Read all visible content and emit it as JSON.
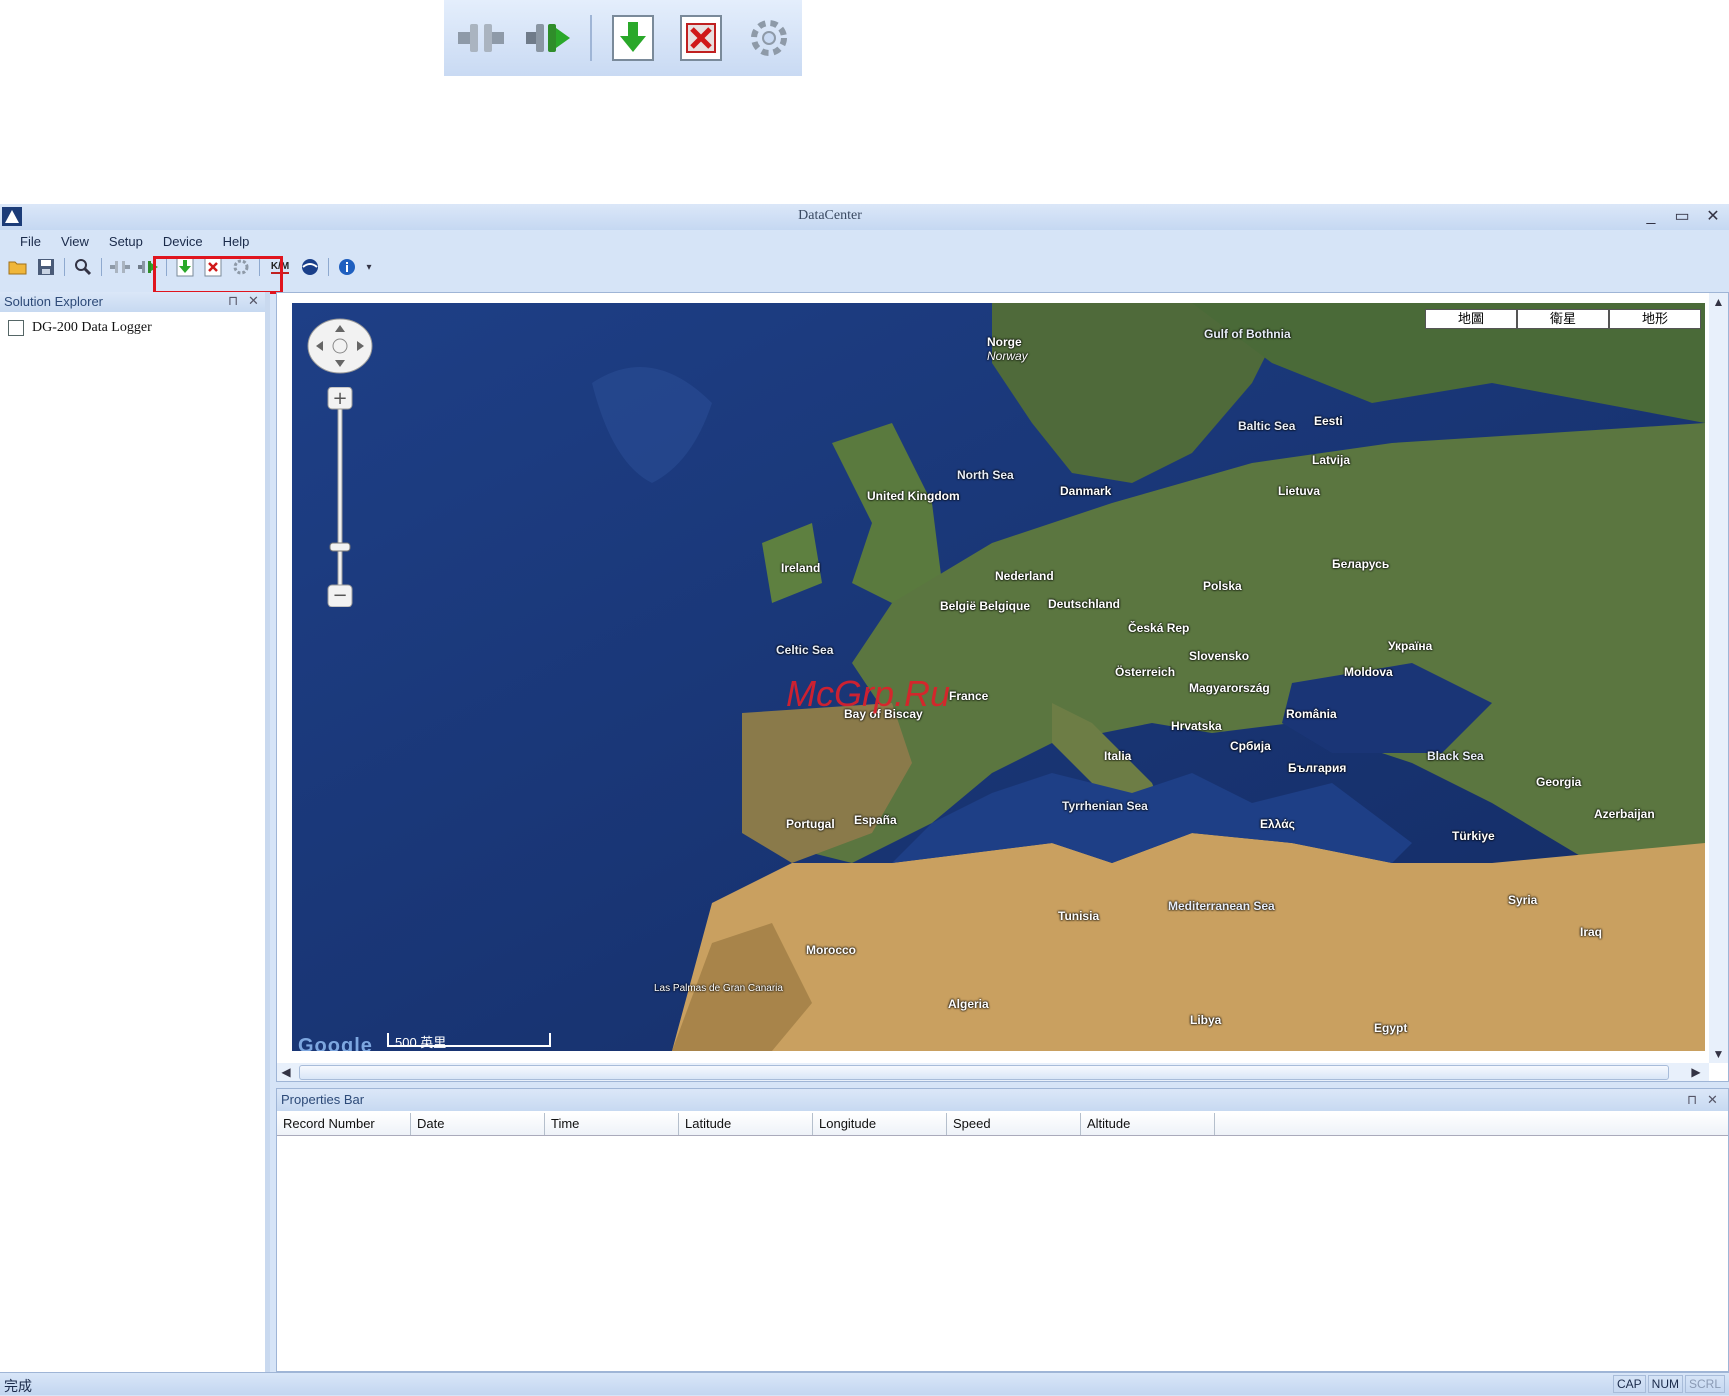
{
  "window": {
    "title": "DataCenter",
    "minimize_icon": "minimize-icon",
    "restore_icon": "restore-icon",
    "close_icon": "close-icon"
  },
  "menu": [
    "File",
    "View",
    "Setup",
    "Device",
    "Help"
  ],
  "toolbar": {
    "icons": [
      "open-folder-icon",
      "save-icon",
      "search-icon",
      "disconnect-icon",
      "connect-icon",
      "download-icon",
      "delete-icon",
      "settings-icon",
      "kml-export-icon",
      "google-earth-icon",
      "info-icon"
    ],
    "km_label": "K/M"
  },
  "solution_explorer": {
    "title": "Solution Explorer",
    "items": [
      {
        "label": "DG-200 Data Logger",
        "checked": false
      }
    ]
  },
  "map": {
    "type_buttons": [
      "地圖",
      "衛星",
      "地形"
    ],
    "scale_label": "500 英里",
    "logo_text": "Google",
    "watermark": "McGrp.Ru",
    "labels": {
      "norge": "Norge",
      "norway": "Norway",
      "gulf_of_bothnia": "Gulf of Bothnia",
      "north_sea": "North Sea",
      "baltic_sea": "Baltic Sea",
      "eesti": "Eesti",
      "latvija": "Latvija",
      "danmark": "Danmark",
      "united_kingdom": "United Kingdom",
      "ireland": "Ireland",
      "nederland": "Nederland",
      "polska": "Polska",
      "deutschland": "Deutschland",
      "belarus": "Беларусь",
      "celtic_sea": "Celtic Sea",
      "ukraina": "Україна",
      "france": "France",
      "bay_of_biscay": "Bay of Biscay",
      "magyarorszag": "Magyarország",
      "romania": "România",
      "moldova": "Moldova",
      "italia": "Italia",
      "espana": "España",
      "portugal": "Portugal",
      "black_sea": "Black Sea",
      "turkiye": "Türkiye",
      "tyrrhenian_sea": "Tyrrhenian Sea",
      "mediterranean_sea": "Mediterranean Sea",
      "morocco": "Morocco",
      "algeria": "Algeria",
      "tunisia": "Tunisia",
      "libya": "Libya",
      "egypt": "Egypt",
      "syria": "Syria",
      "iraq": "Iraq",
      "georgia": "Georgia",
      "azerbaijan": "Azerbaijan",
      "balgaria": "България",
      "srbija": "Србија",
      "slovensko": "Slovensko",
      "ceska_rep": "Česká Rep",
      "osterreich": "Österreich",
      "hrvatska": "Hrvatska",
      "lietuva": "Lietuva",
      "las_palmas": "Las Palmas de Gran Canaria",
      "ellas": "Ελλάς",
      "belgique": "België Belgique"
    }
  },
  "properties_bar": {
    "title": "Properties Bar",
    "columns": [
      "Record Number",
      "Date",
      "Time",
      "Latitude",
      "Longitude",
      "Speed",
      "Altitude"
    ],
    "rows": []
  },
  "status_bar": {
    "text": "完成",
    "indicators": [
      "CAP",
      "NUM",
      "SCRL"
    ]
  }
}
